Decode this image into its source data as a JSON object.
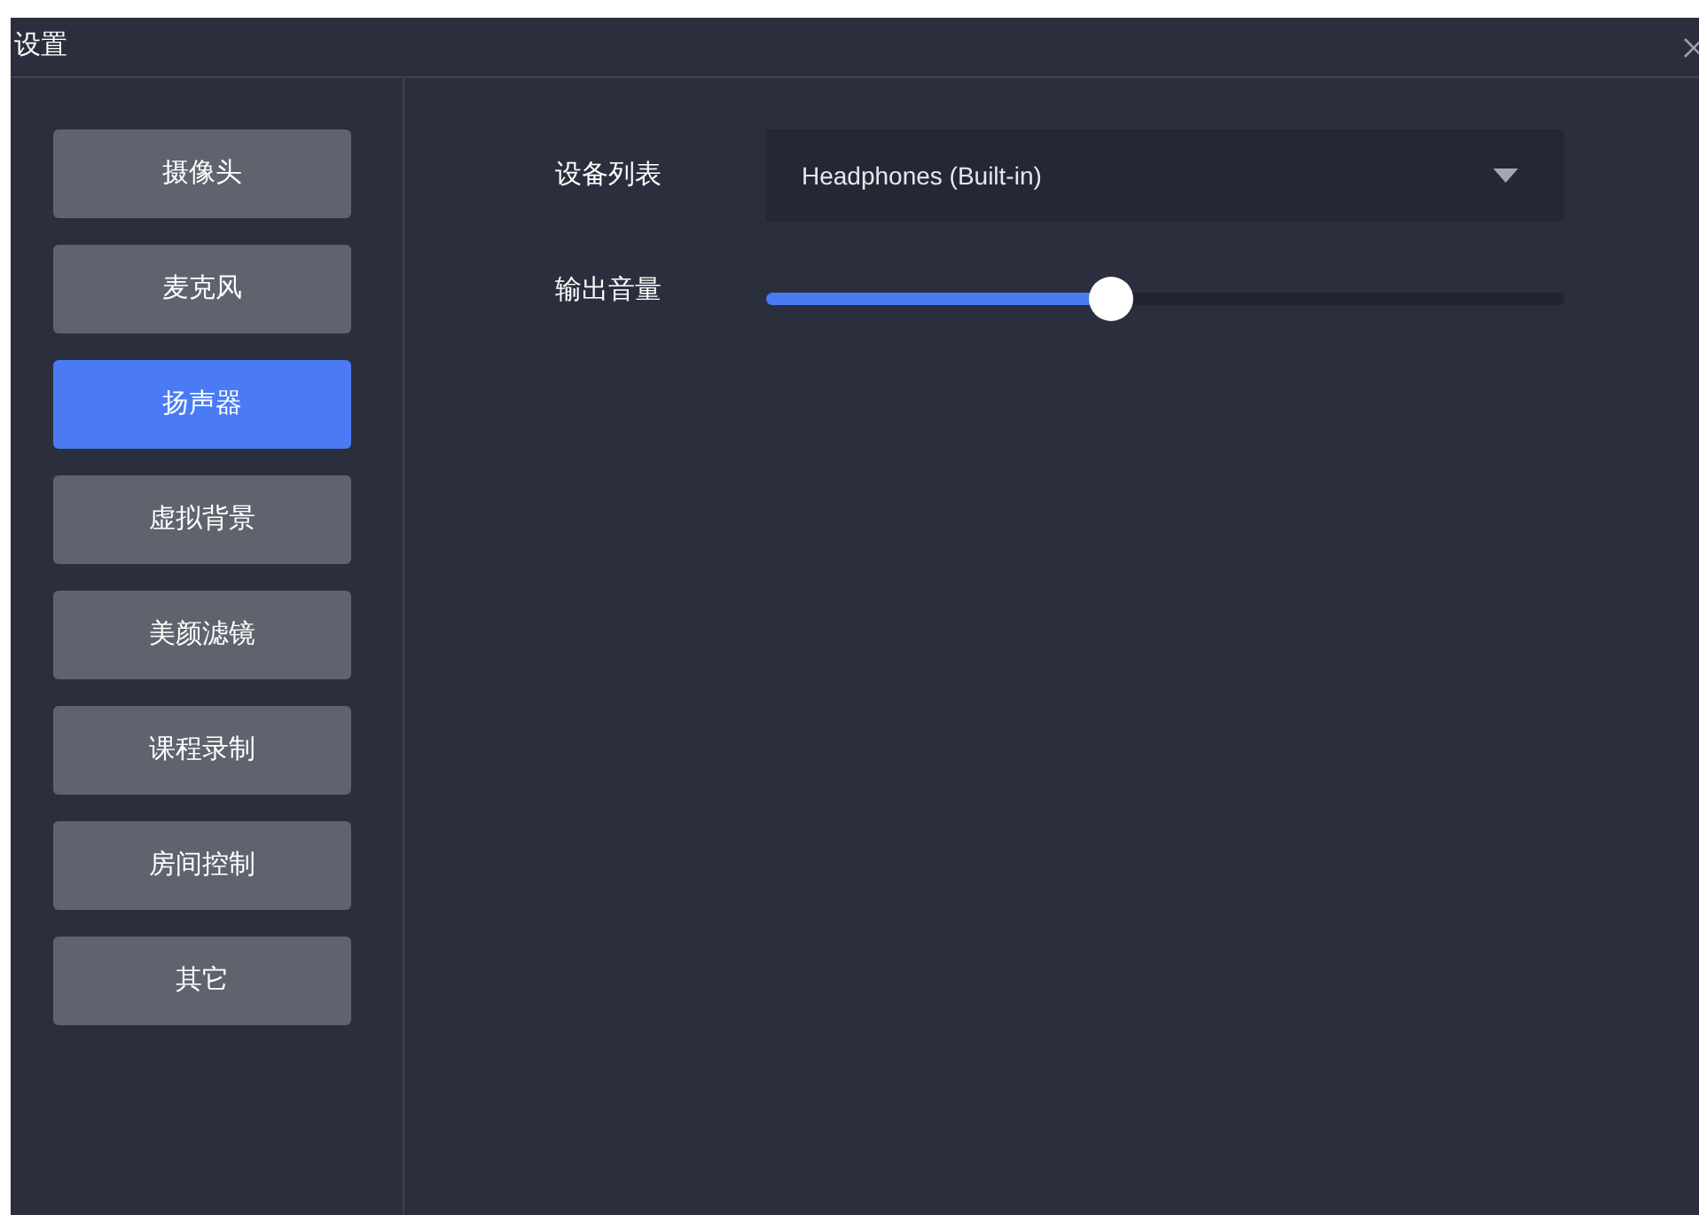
{
  "window": {
    "title": "设置"
  },
  "sidebar": {
    "items": [
      {
        "label": "摄像头",
        "selected": false
      },
      {
        "label": "麦克风",
        "selected": false
      },
      {
        "label": "扬声器",
        "selected": true
      },
      {
        "label": "虚拟背景",
        "selected": false
      },
      {
        "label": "美颜滤镜",
        "selected": false
      },
      {
        "label": "课程录制",
        "selected": false
      },
      {
        "label": "房间控制",
        "selected": false
      },
      {
        "label": "其它",
        "selected": false
      }
    ]
  },
  "device_list": {
    "label": "设备列表",
    "value": "Headphones (Built-in)"
  },
  "output_volume": {
    "label": "输出音量",
    "level": 0.43
  }
}
